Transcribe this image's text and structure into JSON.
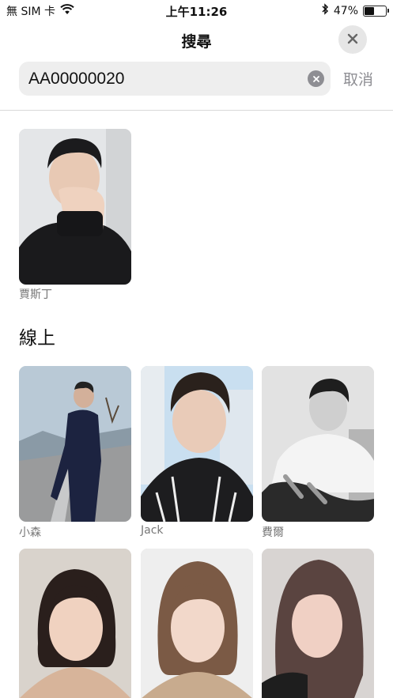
{
  "status_bar": {
    "carrier": "無 SIM 卡",
    "time": "上午11:26",
    "battery_percent": "47%",
    "battery_level": 0.47,
    "icons": [
      "wifi-icon",
      "bluetooth-icon",
      "battery-icon"
    ]
  },
  "header": {
    "title": "搜尋",
    "close_icon": "close-icon"
  },
  "search": {
    "value": "AA00000020",
    "clear_icon": "clear-icon",
    "cancel_label": "取消"
  },
  "result": {
    "name": "賈斯丁"
  },
  "online": {
    "title": "線上",
    "users": [
      {
        "name": "小森"
      },
      {
        "name": "Jack"
      },
      {
        "name": "費爾"
      },
      {
        "name": ""
      },
      {
        "name": ""
      },
      {
        "name": ""
      }
    ]
  },
  "colors": {
    "search_bg": "#eeeeee",
    "secondary_text": "#8e8e93",
    "divider": "#d8d8d8"
  }
}
